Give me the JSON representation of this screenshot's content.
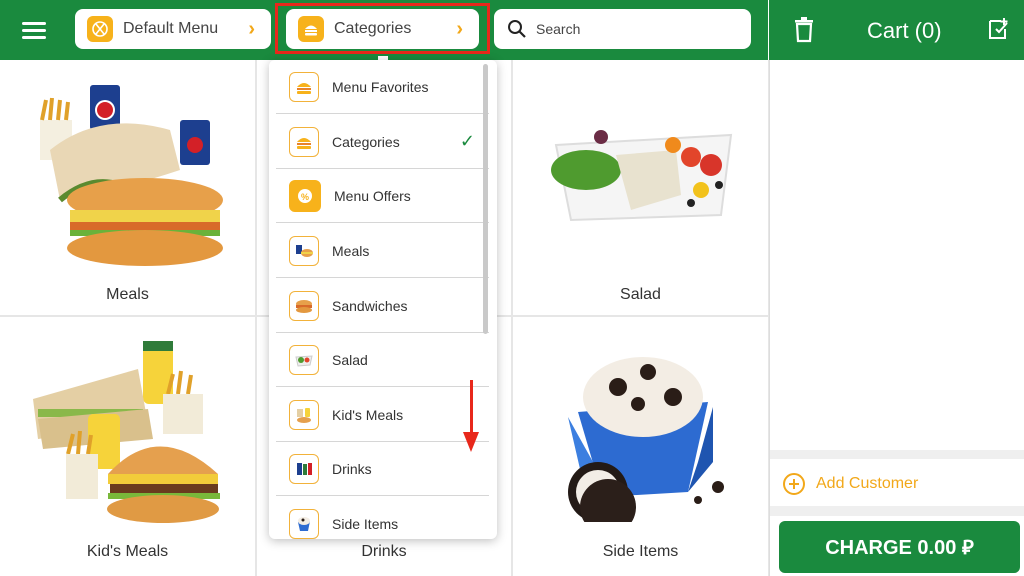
{
  "header": {
    "menu_button_icon": "hamburger-icon",
    "menu_selector": {
      "label": "Default Menu",
      "icon": "utensils-icon"
    },
    "category_selector": {
      "label": "Categories",
      "icon": "burger-icon"
    },
    "search": {
      "placeholder": "Search",
      "icon": "search-icon"
    }
  },
  "cart": {
    "title": "Cart (0)",
    "clear_icon": "trash-icon",
    "new_icon": "add-note-icon",
    "add_customer_label": "Add Customer",
    "charge_label": "CHARGE 0.00 ⃁"
  },
  "tiles": [
    {
      "label": "Meals"
    },
    {
      "label": "Salad"
    },
    {
      "label": "Kid's Meals"
    },
    {
      "label": "Drinks"
    },
    {
      "label": "Side Items"
    }
  ],
  "dropdown": {
    "items": [
      {
        "label": "Menu Favorites",
        "icon": "burger-icon",
        "checked": false
      },
      {
        "label": "Categories",
        "icon": "burger-icon",
        "checked": true
      },
      {
        "label": "Menu Offers",
        "icon": "offer-icon",
        "checked": false
      },
      {
        "label": "Meals",
        "icon": "meal-icon",
        "checked": false
      },
      {
        "label": "Sandwiches",
        "icon": "sandwich-icon",
        "checked": false
      },
      {
        "label": "Salad",
        "icon": "salad-icon",
        "checked": false
      },
      {
        "label": "Kid's Meals",
        "icon": "kids-meal-icon",
        "checked": false
      },
      {
        "label": "Drinks",
        "icon": "drinks-icon",
        "checked": false
      },
      {
        "label": "Side Items",
        "icon": "side-items-icon",
        "checked": false
      }
    ],
    "check_mark": "✓"
  },
  "colors": {
    "brand_green": "#1a8a3e",
    "accent_orange": "#f7b21b",
    "annotation_red": "#e8281b"
  }
}
